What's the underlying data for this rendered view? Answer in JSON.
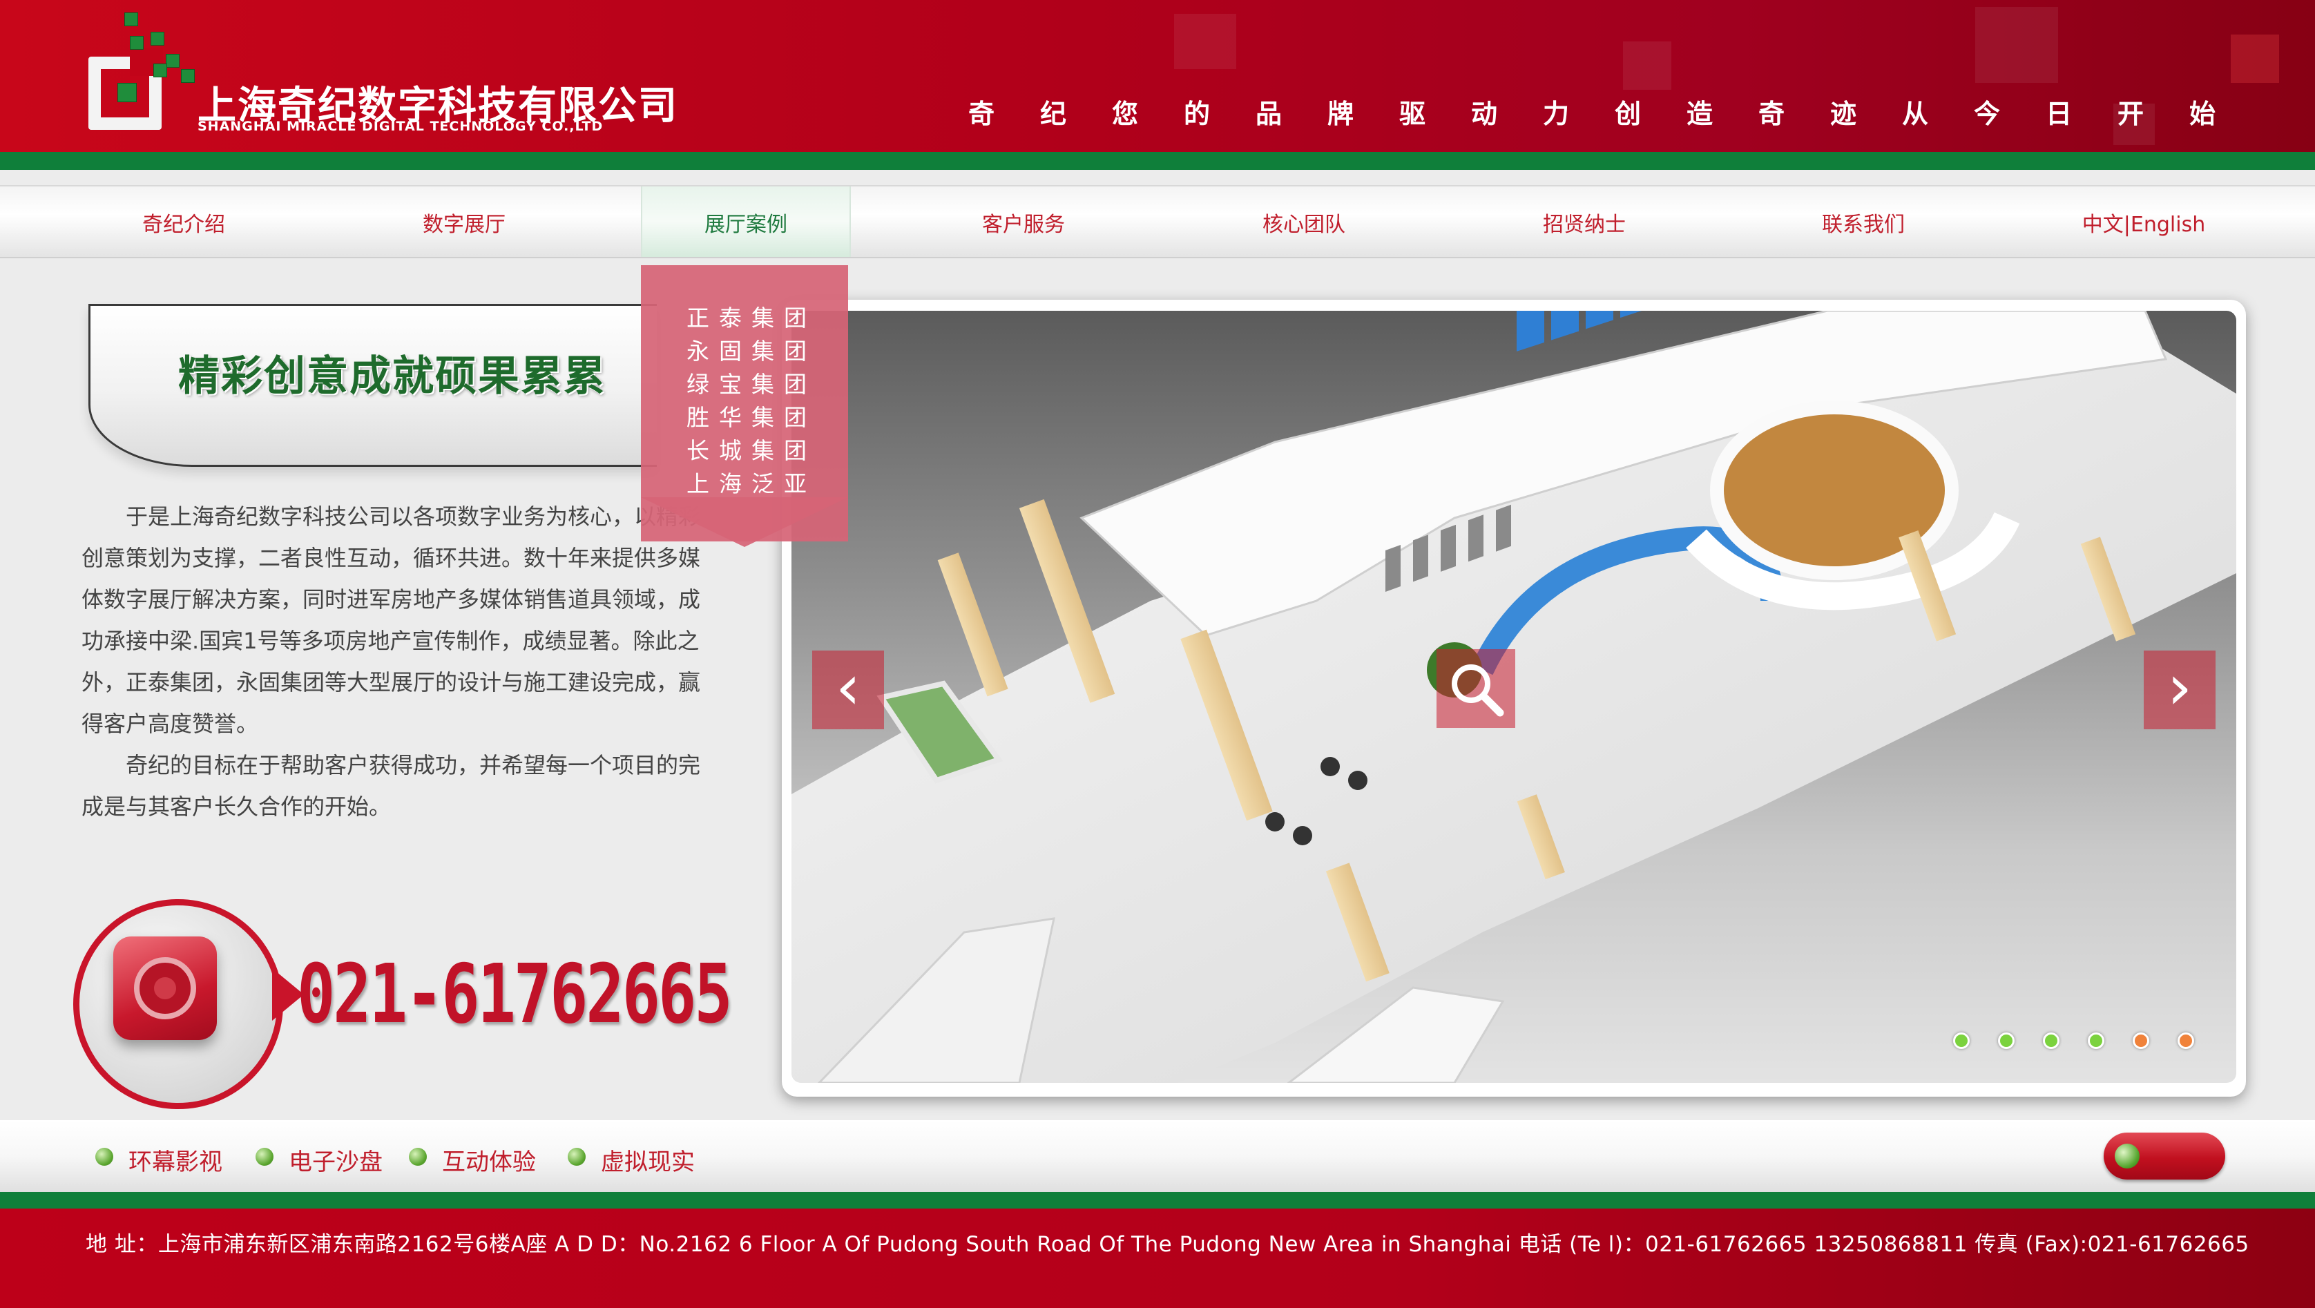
{
  "header": {
    "company_cn": "上海奇纪数字科技有限公司",
    "company_en": "SHANGHAI MIRACLE DIGITAL TECHNOLOGY CO.,LTD",
    "slogan": "奇纪您的品牌驱动力创造奇迹从今日开始",
    "brand_red": "#c8061a",
    "brand_green": "#0f7f3a"
  },
  "nav": {
    "items": [
      {
        "label": "奇纪介绍"
      },
      {
        "label": "数字展厅"
      },
      {
        "label": "展厅案例",
        "active": true
      },
      {
        "label": "客户服务"
      },
      {
        "label": "核心团队"
      },
      {
        "label": "招贤纳士"
      },
      {
        "label": "联系我们"
      },
      {
        "label": "中文|English"
      }
    ],
    "dropdown": [
      "正泰集团",
      "永固集团",
      "绿宝集团",
      "胜华集团",
      "长城集团",
      "上海泛亚"
    ]
  },
  "main": {
    "headline": "精彩创意成就硕果累累",
    "paragraphs": [
      "于是上海奇纪数字科技公司以各项数字业务为核心，以精彩创意策划为支撑，二者良性互动，循环共进。数十年来提供多媒体数字展厅解决方案，同时进军房地产多媒体销售道具领域，成功承接中梁.国宾1号等多项房地产宣传制作，成绩显著。除此之外，正泰集团，永固集团等大型展厅的设计与施工建设完成，赢得客户高度赞誉。",
      "奇纪的目标在于帮助客户获得成功，并希望每一个项目的完成是与其客户长久合作的开始。"
    ],
    "phone": "021-61762665"
  },
  "showcase": {
    "prev_icon": "chevron-left-icon",
    "next_icon": "chevron-right-icon",
    "zoom_icon": "magnifier-icon",
    "slides": 6,
    "active_slide": 5,
    "dot_colors": [
      "#7bd23e",
      "#7bd23e",
      "#7bd23e",
      "#7bd23e",
      "#f0823a",
      "#f0823a"
    ]
  },
  "bottom_links": [
    "环幕影视",
    "电子沙盘",
    "互动体验",
    "虚拟现实"
  ],
  "footer": {
    "address": "地      址：上海市浦东新区浦东南路2162号6楼A座   A    D    D：No.2162 6 Floor A Of Pudong South Road Of The Pudong New Area in Shanghai  电话 (Te l)：021-61762665 13250868811  传真 (Fax):021-61762665"
  }
}
